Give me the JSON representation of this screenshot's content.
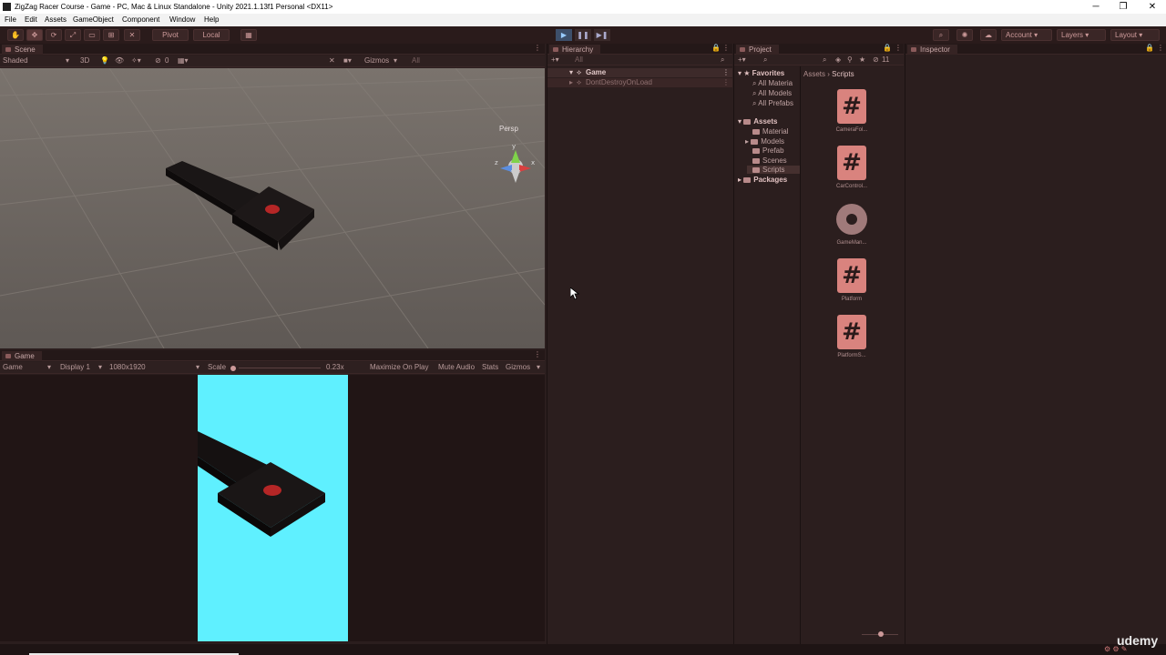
{
  "window": {
    "title": "ZigZag Racer Course - Game - PC, Mac & Linux Standalone - Unity 2021.1.13f1 Personal <DX11>",
    "minimize": "─",
    "restore": "❐",
    "close": "✕"
  },
  "menu": [
    "File",
    "Edit",
    "Assets",
    "GameObject",
    "Component",
    "Window",
    "Help"
  ],
  "toolbar": {
    "pivot_label": "Pivot",
    "local_label": "Local",
    "account_label": "Account",
    "layers_label": "Layers",
    "layout_label": "Layout"
  },
  "scene": {
    "tab_label": "Scene",
    "shading_mode": "Shaded",
    "mode_2d3d": "3D",
    "gizmos_label": "Gizmos",
    "search_placeholder": "All",
    "hidden_count": "0",
    "persp_label": "Persp"
  },
  "game": {
    "tab_label": "Game",
    "view_select": "Game",
    "display_select": "Display 1",
    "resolution_select": "1080x1920",
    "scale_label": "Scale",
    "scale_value": "0.23x",
    "maximize_label": "Maximize On Play",
    "mute_label": "Mute Audio",
    "stats_label": "Stats",
    "gizmos_label": "Gizmos",
    "background_color": "#5ff0ff"
  },
  "hierarchy": {
    "tab_label": "Hierarchy",
    "search_placeholder": "All",
    "items": [
      "Game",
      "DontDestroyOnLoad"
    ]
  },
  "project": {
    "tab_label": "Project",
    "hidden_count": "11",
    "favorites_label": "Favorites",
    "favorites": [
      "All Materia",
      "All Models",
      "All Prefabs"
    ],
    "assets_label": "Assets",
    "asset_folders": [
      "Material",
      "Models",
      "Prefab",
      "Scenes",
      "Scripts"
    ],
    "packages_label": "Packages",
    "breadcrumb": [
      "Assets",
      "Scripts"
    ],
    "files": [
      {
        "name": "CameraFol...",
        "icon": "csharp-script-icon"
      },
      {
        "name": "CarControl...",
        "icon": "csharp-script-icon"
      },
      {
        "name": "GameMan...",
        "icon": "gear-icon"
      },
      {
        "name": "Platform",
        "icon": "csharp-script-icon"
      },
      {
        "name": "PlatformS...",
        "icon": "csharp-script-icon"
      }
    ]
  },
  "inspector": {
    "tab_label": "Inspector"
  },
  "watermark": "udemy"
}
